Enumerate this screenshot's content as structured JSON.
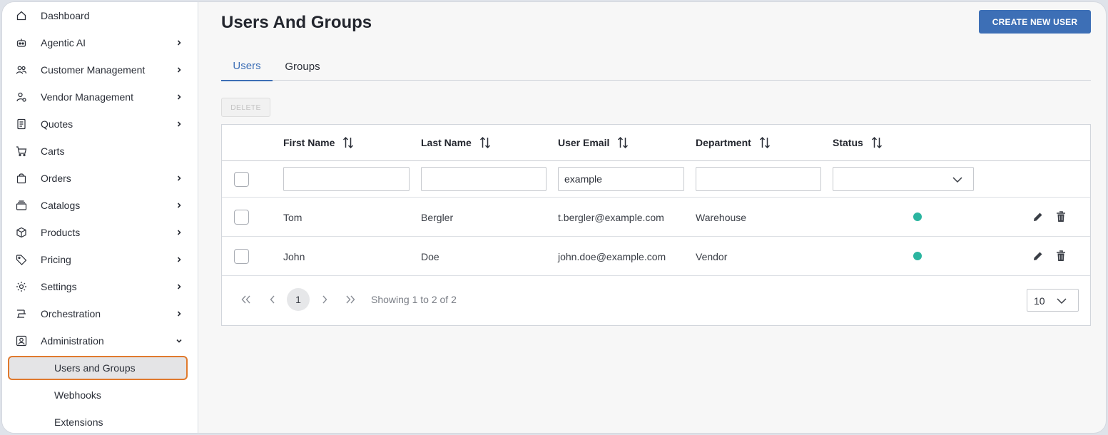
{
  "sidebar": {
    "items": [
      {
        "label": "Dashboard",
        "icon": "home-icon",
        "chevron": false
      },
      {
        "label": "Agentic AI",
        "icon": "robot-icon",
        "chevron": true
      },
      {
        "label": "Customer Management",
        "icon": "users-icon",
        "chevron": true
      },
      {
        "label": "Vendor Management",
        "icon": "vendor-icon",
        "chevron": true
      },
      {
        "label": "Quotes",
        "icon": "document-icon",
        "chevron": true
      },
      {
        "label": "Carts",
        "icon": "cart-icon",
        "chevron": false
      },
      {
        "label": "Orders",
        "icon": "bag-icon",
        "chevron": true
      },
      {
        "label": "Catalogs",
        "icon": "catalog-icon",
        "chevron": true
      },
      {
        "label": "Products",
        "icon": "box-icon",
        "chevron": true
      },
      {
        "label": "Pricing",
        "icon": "tag-icon",
        "chevron": true
      },
      {
        "label": "Settings",
        "icon": "gear-icon",
        "chevron": true
      },
      {
        "label": "Orchestration",
        "icon": "orchestration-icon",
        "chevron": true
      },
      {
        "label": "Administration",
        "icon": "admin-icon",
        "chevron": "down"
      }
    ],
    "subitems": [
      {
        "label": "Users and Groups",
        "active": true
      },
      {
        "label": "Webhooks",
        "active": false
      },
      {
        "label": "Extensions",
        "active": false
      }
    ]
  },
  "header": {
    "title": "Users And Groups",
    "create_button": "CREATE NEW USER"
  },
  "tabs": [
    "Users",
    "Groups"
  ],
  "toolbar": {
    "delete_label": "DELETE"
  },
  "table": {
    "columns": [
      "First Name",
      "Last Name",
      "User Email",
      "Department",
      "Status"
    ],
    "filters": {
      "first_name": "",
      "last_name": "",
      "email": "example",
      "department": "",
      "status": ""
    },
    "rows": [
      {
        "first": "Tom",
        "last": "Bergler",
        "email": "t.bergler@example.com",
        "department": "Warehouse",
        "status": "active"
      },
      {
        "first": "John",
        "last": "Doe",
        "email": "john.doe@example.com",
        "department": "Vendor",
        "status": "active"
      }
    ]
  },
  "pagination": {
    "current_page": "1",
    "summary": "Showing 1 to 2 of 2",
    "page_size": "10"
  },
  "colors": {
    "accent": "#3d6fb6",
    "status_active": "#2bb5a0",
    "active_outline": "#e07a2e"
  }
}
